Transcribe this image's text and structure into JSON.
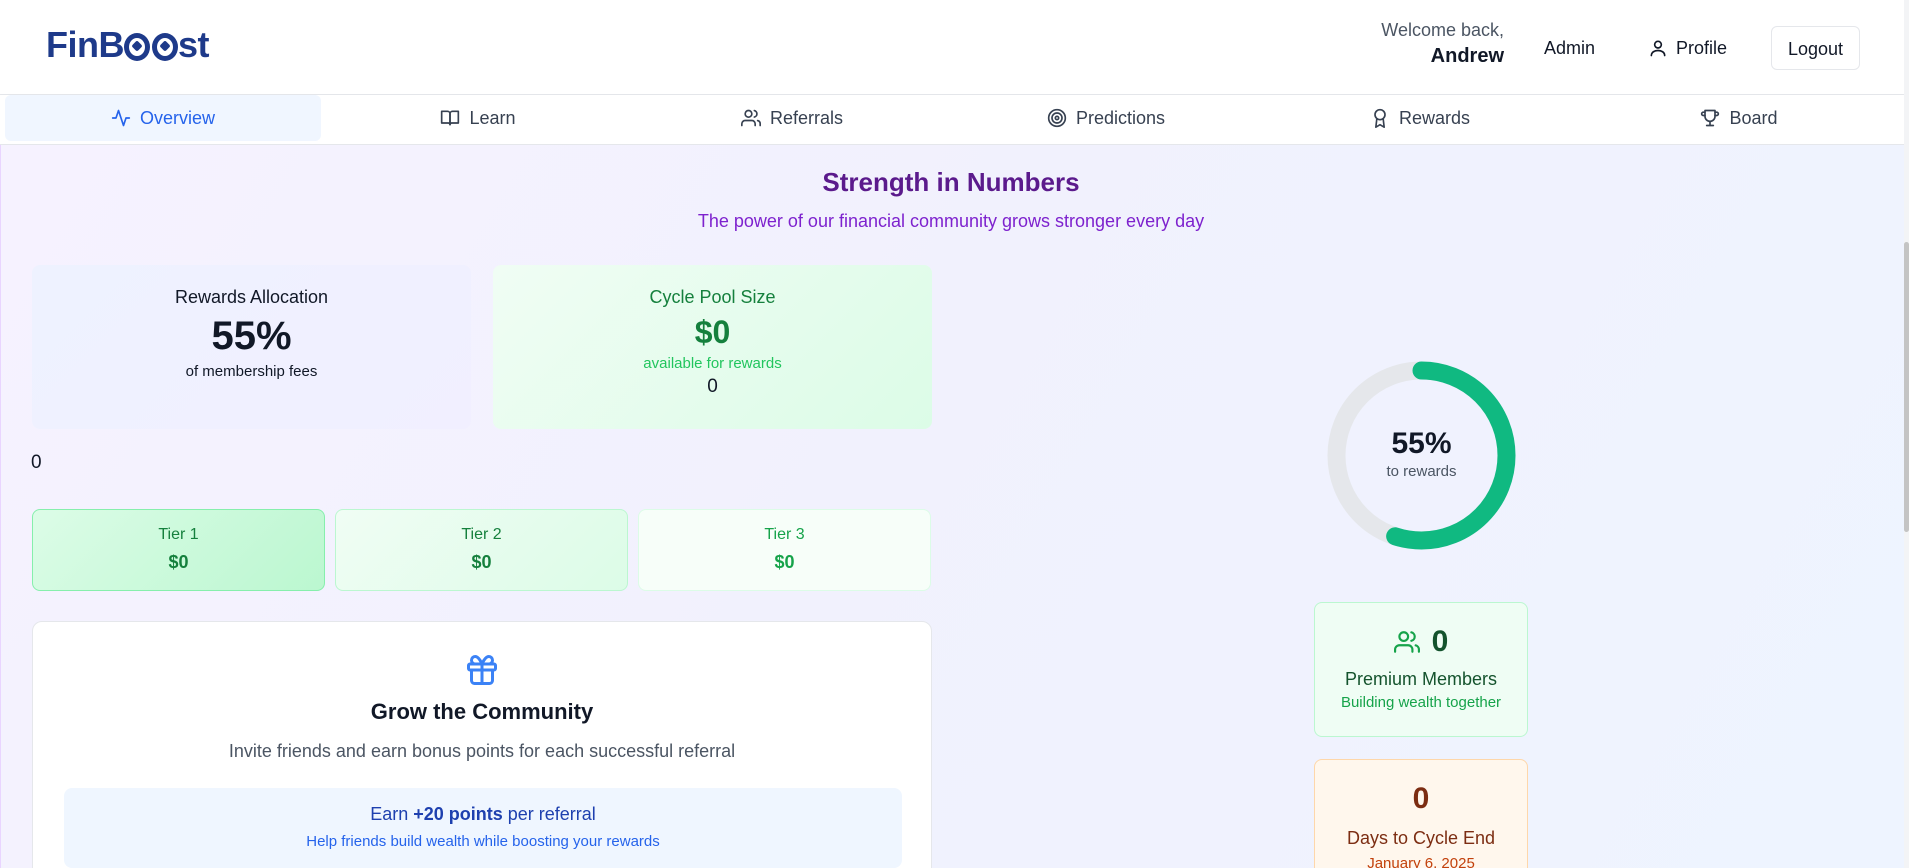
{
  "header": {
    "logo": "FinBoost",
    "welcome_line1": "Welcome back,",
    "welcome_name": "Andrew",
    "admin_label": "Admin",
    "profile_label": "Profile",
    "logout_label": "Logout"
  },
  "tabs": [
    {
      "label": "Overview",
      "icon": "activity-icon",
      "active": true
    },
    {
      "label": "Learn",
      "icon": "book-icon",
      "active": false
    },
    {
      "label": "Referrals",
      "icon": "users-icon",
      "active": false
    },
    {
      "label": "Predictions",
      "icon": "target-icon",
      "active": false
    },
    {
      "label": "Rewards",
      "icon": "award-icon",
      "active": false
    },
    {
      "label": "Board",
      "icon": "trophy-icon",
      "active": false
    }
  ],
  "main": {
    "title": "Strength in Numbers",
    "subtitle": "The power of our financial community grows stronger every day",
    "allocation": {
      "title": "Rewards Allocation",
      "value": "55%",
      "sub": "of membership fees"
    },
    "pool": {
      "title": "Cycle Pool Size",
      "value": "$0",
      "sub": "available for rewards",
      "extra": "0"
    },
    "stray_zero": "0",
    "tiers": [
      {
        "name": "Tier 1",
        "amount": "$0"
      },
      {
        "name": "Tier 2",
        "amount": "$0"
      },
      {
        "name": "Tier 3",
        "amount": "$0"
      }
    ],
    "community": {
      "title": "Grow the Community",
      "subtitle": "Invite friends and earn bonus points for each successful referral",
      "earn_prefix": "Earn ",
      "earn_bold": "+20 points",
      "earn_suffix": " per referral",
      "earn_sub": "Help friends build wealth while boosting your rewards"
    },
    "donut": {
      "percent_label": "55%",
      "label": "to rewards",
      "fraction": 0.55,
      "fill_color": "#10b981",
      "track_color": "#e5e7eb"
    },
    "members": {
      "count": "0",
      "label": "Premium Members",
      "sub": "Building wealth together"
    },
    "days": {
      "count": "0",
      "label": "Days to Cycle End",
      "sub": "January 6, 2025"
    }
  },
  "colors": {
    "accent": "#2563eb",
    "brand": "#1e3a8a",
    "purple": "#5b1a8c",
    "green": "#15803d"
  }
}
